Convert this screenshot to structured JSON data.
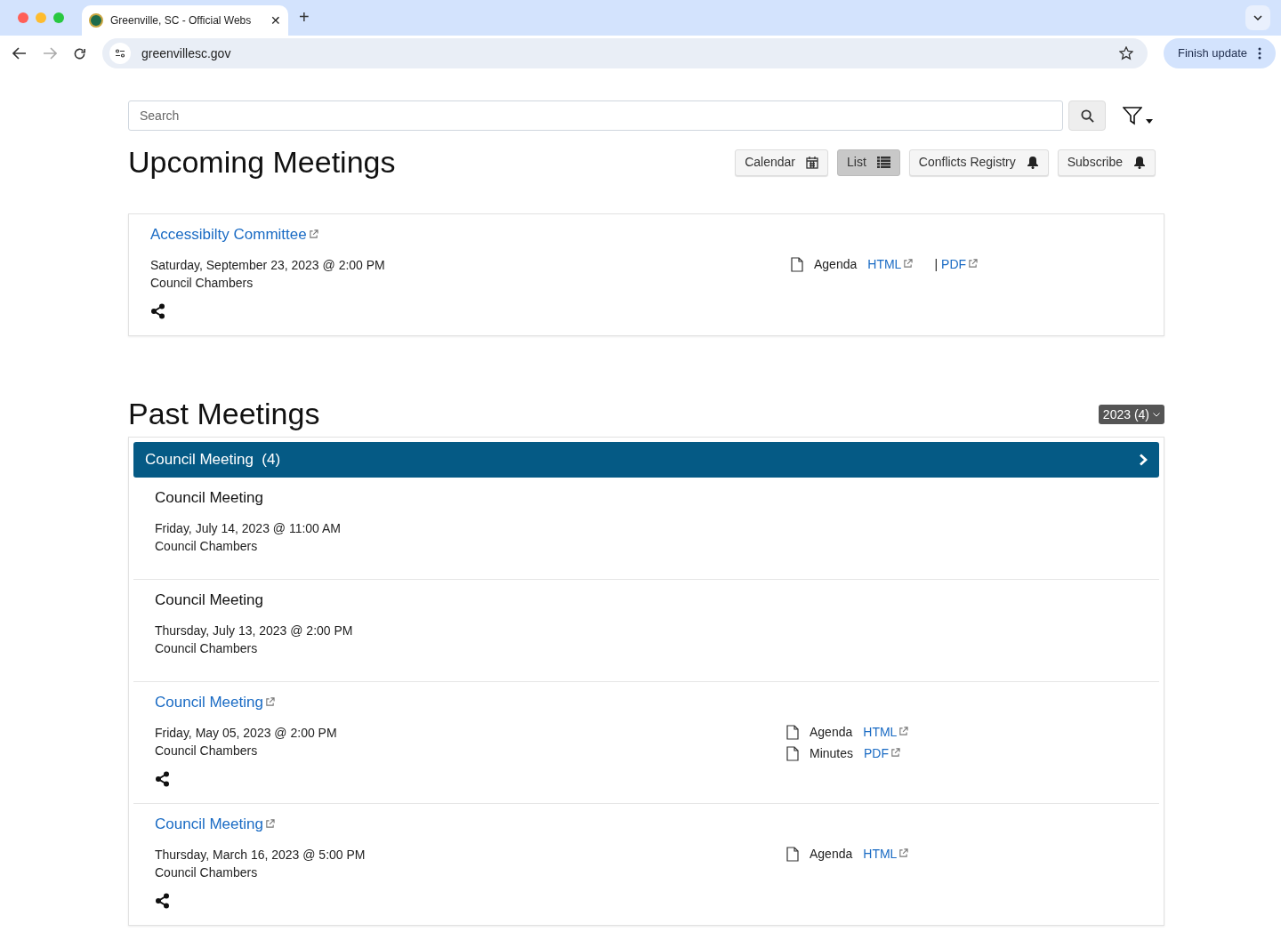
{
  "browser": {
    "tab_title": "Greenville, SC - Official Webs",
    "url": "greenvillesc.gov",
    "update_button": "Finish update",
    "tab_close": "✕",
    "new_tab": "+"
  },
  "search": {
    "placeholder": "Search"
  },
  "upcoming": {
    "title": "Upcoming Meetings",
    "views": [
      {
        "label": "Calendar",
        "kind": "calendar",
        "selected": false
      },
      {
        "label": "List",
        "kind": "list",
        "selected": true
      },
      {
        "label": "Conflicts Registry",
        "kind": "bell",
        "selected": false
      },
      {
        "label": "Subscribe",
        "kind": "bell",
        "selected": false
      }
    ],
    "meetings": [
      {
        "title": "Accessibilty Committee",
        "linked": true,
        "date": "Saturday, September 23, 2023 @ 2:00 PM",
        "location": "Council Chambers",
        "shareable": true,
        "documents": [
          {
            "label": "Agenda",
            "links": [
              {
                "label": "HTML"
              },
              {
                "separator": "|",
                "label": "PDF"
              }
            ]
          }
        ]
      }
    ]
  },
  "past": {
    "title": "Past Meetings",
    "year_selector": "2023 (4)",
    "group": {
      "title": "Council Meeting",
      "count": "(4)"
    },
    "meetings": [
      {
        "title": "Council Meeting",
        "linked": false,
        "date": "Friday, July 14, 2023 @ 11:00 AM",
        "location": "Council Chambers",
        "shareable": false
      },
      {
        "title": "Council Meeting",
        "linked": false,
        "date": "Thursday, July 13, 2023 @ 2:00 PM",
        "location": "Council Chambers",
        "shareable": false
      },
      {
        "title": "Council Meeting",
        "linked": true,
        "date": "Friday, May 05, 2023 @ 2:00 PM",
        "location": "Council Chambers",
        "shareable": true,
        "documents": [
          {
            "label": "Agenda",
            "links": [
              {
                "label": "HTML"
              }
            ]
          },
          {
            "label": "Minutes",
            "links": [
              {
                "label": "PDF"
              }
            ]
          }
        ]
      },
      {
        "title": "Council Meeting",
        "linked": true,
        "date": "Thursday, March 16, 2023 @ 5:00 PM",
        "location": "Council Chambers",
        "shareable": true,
        "documents": [
          {
            "label": "Agenda",
            "links": [
              {
                "label": "HTML"
              }
            ]
          }
        ]
      }
    ]
  }
}
